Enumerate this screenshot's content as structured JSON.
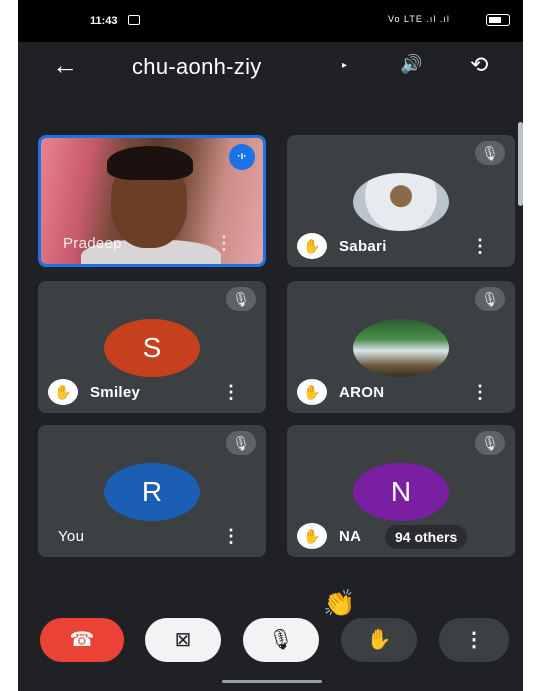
{
  "status": {
    "time": "11:43",
    "signal": "Vo LTE .ıl .ıl",
    "battery_icon": "battery-icon"
  },
  "header": {
    "title": "chu-aonh-ziy",
    "caret": "▸",
    "back": "←",
    "speaker": "🔊",
    "switch_camera": "⟲"
  },
  "tiles": [
    {
      "name": "Pradeep",
      "speaking": "·ı·",
      "menu": "⋮"
    },
    {
      "name": "Sabari",
      "menu": "⋮",
      "mic": "🎙"
    },
    {
      "name": "Smiley",
      "initial": "S",
      "color": "#c5401d",
      "menu": "⋮",
      "mic": "🎙"
    },
    {
      "name": "ARON",
      "menu": "⋮",
      "mic": "🎙"
    },
    {
      "name": "You",
      "initial": "R",
      "color": "#1a5fb4",
      "menu": "⋮",
      "mic": "🎙"
    },
    {
      "name": "NA",
      "initial": "N",
      "color": "#7b1fa2",
      "others": "94 others",
      "mic": "🎙"
    }
  ],
  "reaction": "👏",
  "controls": {
    "end_call": "☎",
    "camera_off": "⊠",
    "mic_off": "🎙",
    "raise_hand": "✋",
    "more": "⋮"
  },
  "colors": {
    "background": "#202124",
    "tile": "#3c4043",
    "end_call": "#ea4335",
    "active_border": "#1a73e8"
  }
}
